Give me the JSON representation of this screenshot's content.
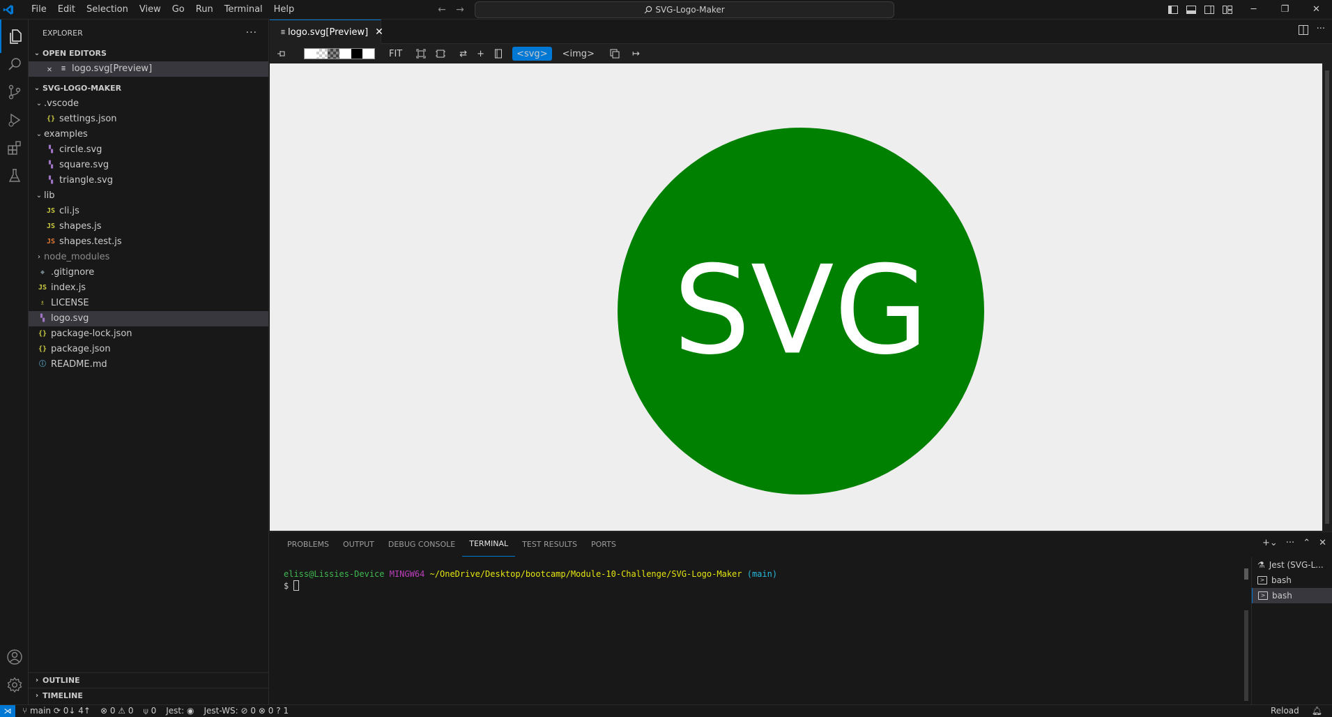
{
  "window": {
    "title": "SVG-Logo-Maker"
  },
  "menu": [
    "File",
    "Edit",
    "Selection",
    "View",
    "Go",
    "Run",
    "Terminal",
    "Help"
  ],
  "sidebar": {
    "title": "EXPLORER",
    "open_editors": {
      "title": "OPEN EDITORS",
      "items": [
        {
          "name": "logo.svg[Preview]"
        }
      ]
    },
    "project": {
      "title": "SVG-LOGO-MAKER",
      "tree": [
        {
          "label": ".vscode",
          "type": "folder",
          "expanded": true,
          "depth": 0
        },
        {
          "label": "settings.json",
          "type": "json",
          "depth": 1
        },
        {
          "label": "examples",
          "type": "folder",
          "expanded": true,
          "depth": 0
        },
        {
          "label": "circle.svg",
          "type": "svg",
          "depth": 1
        },
        {
          "label": "square.svg",
          "type": "svg",
          "depth": 1
        },
        {
          "label": "triangle.svg",
          "type": "svg",
          "depth": 1
        },
        {
          "label": "lib",
          "type": "folder",
          "expanded": true,
          "depth": 0
        },
        {
          "label": "cli.js",
          "type": "js",
          "depth": 1
        },
        {
          "label": "shapes.js",
          "type": "js",
          "depth": 1
        },
        {
          "label": "shapes.test.js",
          "type": "test",
          "depth": 1
        },
        {
          "label": "node_modules",
          "type": "folder",
          "expanded": false,
          "depth": 0
        },
        {
          "label": ".gitignore",
          "type": "git",
          "depth": 0
        },
        {
          "label": "index.js",
          "type": "js",
          "depth": 0
        },
        {
          "label": "LICENSE",
          "type": "lic",
          "depth": 0
        },
        {
          "label": "logo.svg",
          "type": "svg",
          "depth": 0,
          "selected": true
        },
        {
          "label": "package-lock.json",
          "type": "json",
          "depth": 0
        },
        {
          "label": "package.json",
          "type": "json",
          "depth": 0
        },
        {
          "label": "README.md",
          "type": "md",
          "depth": 0
        }
      ]
    },
    "outline": "OUTLINE",
    "timeline": "TIMELINE"
  },
  "editor": {
    "tab": "logo.svg[Preview]",
    "toolbar": {
      "fit": "FIT",
      "svg_mode": "<svg>",
      "img_mode": "<img>"
    },
    "preview": {
      "logo_text": "SVG",
      "circle_color": "#008000",
      "text_color": "#ffffff",
      "background": "#eeeeee"
    }
  },
  "panel": {
    "tabs": [
      "PROBLEMS",
      "OUTPUT",
      "DEBUG CONSOLE",
      "TERMINAL",
      "TEST RESULTS",
      "PORTS"
    ],
    "active_tab": "TERMINAL",
    "terminal": {
      "user": "eliss@Lissies-Device",
      "shell": "MINGW64",
      "path": "~/OneDrive/Desktop/bootcamp/Module-10-Challenge/SVG-Logo-Maker",
      "branch": "(main)",
      "prompt": "$"
    },
    "terminals": [
      "Jest (SVG-L...",
      "bash",
      "bash"
    ]
  },
  "statusbar": {
    "branch": "main",
    "sync": "0↓ 4↑",
    "errors": "0",
    "warnings": "0",
    "ports": "0",
    "jest": "Jest:",
    "jest_ws": "Jest-WS:",
    "jest_ws_pass": "0",
    "jest_ws_fail": "0",
    "jest_ws_unknown": "1",
    "reload": "Reload"
  }
}
